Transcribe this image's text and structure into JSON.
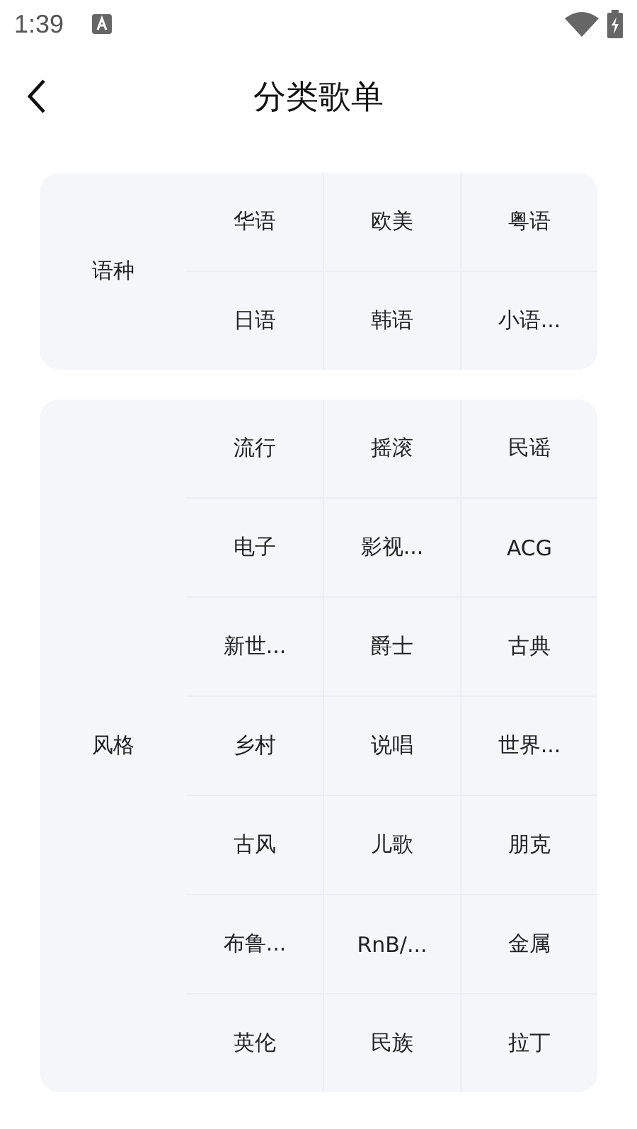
{
  "status_bar": {
    "time": "1:39"
  },
  "header": {
    "title": "分类歌单"
  },
  "groups": [
    {
      "label": "语种",
      "tags": [
        "华语",
        "欧美",
        "粤语",
        "日语",
        "韩语",
        "小语..."
      ]
    },
    {
      "label": "风格",
      "tags": [
        "流行",
        "摇滚",
        "民谣",
        "电子",
        "影视...",
        "ACG",
        "新世...",
        "爵士",
        "古典",
        "乡村",
        "说唱",
        "世界...",
        "古风",
        "儿歌",
        "朋克",
        "布鲁...",
        "RnB/...",
        "金属",
        "英伦",
        "民族",
        "拉丁"
      ]
    }
  ]
}
